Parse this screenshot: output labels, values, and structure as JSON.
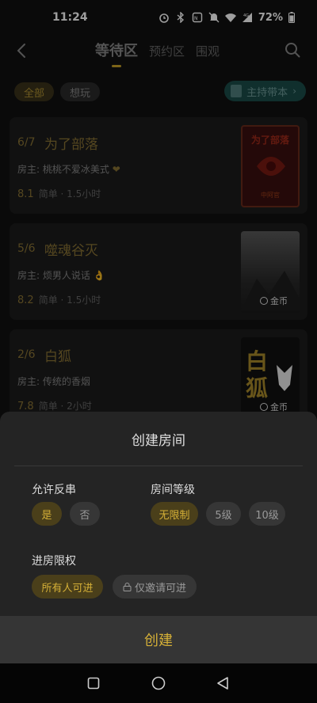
{
  "status_bar": {
    "time": "11:24",
    "battery": "72%",
    "signal_badge": "4G"
  },
  "header": {
    "tabs": [
      {
        "label": "等待区",
        "active": true
      },
      {
        "label": "预约区",
        "active": false
      },
      {
        "label": "围观",
        "active": false
      }
    ]
  },
  "filters": {
    "chips": [
      {
        "label": "全部",
        "active": true
      },
      {
        "label": "想玩",
        "active": false
      }
    ],
    "host_button": "主持带本"
  },
  "rooms": [
    {
      "count": "6/7",
      "title": "为了部落",
      "owner_prefix": "房主:",
      "owner": "桃桃不爱冰美式",
      "score": "8.1",
      "meta": "简单 · 1.5小时",
      "cover_text": "为了部落",
      "cover_sub": "中阿官",
      "coin_tag": ""
    },
    {
      "count": "5/6",
      "title": "噬魂谷灭",
      "owner_prefix": "房主:",
      "owner": "烦男人说话",
      "score": "8.2",
      "meta": "简单 · 1.5小时",
      "cover_text": "",
      "cover_sub": "",
      "coin_tag": "金币"
    },
    {
      "count": "2/6",
      "title": "白狐",
      "owner_prefix": "房主:",
      "owner": "传统的香烟",
      "score": "7.8",
      "meta": "简单 · 2小时",
      "cover_text": "白狐",
      "cover_sub": "",
      "coin_tag": "金币"
    }
  ],
  "sheet": {
    "title": "创建房间",
    "allow_reverse": {
      "label": "允许反串",
      "options": [
        "是",
        "否"
      ],
      "selected": "是"
    },
    "room_level": {
      "label": "房间等级",
      "options": [
        "无限制",
        "5级",
        "10级"
      ],
      "selected": "无限制"
    },
    "entry_permission": {
      "label": "进房限权",
      "options": [
        "所有人可进",
        "仅邀请可进"
      ],
      "selected": "所有人可进"
    },
    "create_button": "创建"
  },
  "colors": {
    "accent": "#d4af37",
    "background": "#111111",
    "sheet": "#242424"
  }
}
